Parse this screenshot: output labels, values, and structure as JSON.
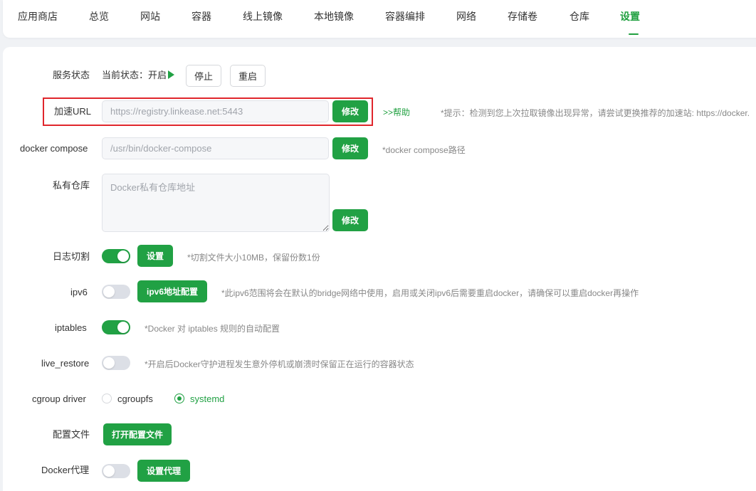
{
  "tabs": [
    {
      "label": "应用商店"
    },
    {
      "label": "总览"
    },
    {
      "label": "网站"
    },
    {
      "label": "容器"
    },
    {
      "label": "线上镜像"
    },
    {
      "label": "本地镜像"
    },
    {
      "label": "容器编排"
    },
    {
      "label": "网络"
    },
    {
      "label": "存储卷"
    },
    {
      "label": "仓库"
    },
    {
      "label": "设置",
      "active": true
    }
  ],
  "service": {
    "label": "服务状态",
    "status_text": "当前状态：开启",
    "stop_label": "停止",
    "restart_label": "重启"
  },
  "mirror": {
    "label": "加速URL",
    "placeholder": "https://registry.linkease.net:5443",
    "modify_label": "修改",
    "help_link": ">>帮助",
    "hint": "*提示：检测到您上次拉取镜像出现异常，请尝试更换推荐的加速站: https://docker."
  },
  "compose": {
    "label": "docker compose",
    "placeholder": "/usr/bin/docker-compose",
    "modify_label": "修改",
    "hint": "*docker compose路径"
  },
  "private_registry": {
    "label": "私有仓库",
    "placeholder": "Docker私有仓库地址",
    "modify_label": "修改"
  },
  "log_rotate": {
    "label": "日志切割",
    "enabled": true,
    "button_label": "设置",
    "hint": "*切割文件大小10MB，保留份数1份"
  },
  "ipv6": {
    "label": "ipv6",
    "enabled": false,
    "button_label": "ipv6地址配置",
    "hint": "*此ipv6范围将会在默认的bridge网络中使用，启用或关闭ipv6后需要重启docker，请确保可以重启docker再操作"
  },
  "iptables": {
    "label": "iptables",
    "enabled": true,
    "hint": "*Docker 对 iptables 规则的自动配置"
  },
  "live_restore": {
    "label": "live_restore",
    "enabled": false,
    "hint": "*开启后Docker守护进程发生意外停机或崩溃时保留正在运行的容器状态"
  },
  "cgroup": {
    "label": "cgroup driver",
    "options": [
      "cgroupfs",
      "systemd"
    ],
    "selected": "systemd"
  },
  "config_file": {
    "label": "配置文件",
    "button_label": "打开配置文件"
  },
  "proxy": {
    "label": "Docker代理",
    "enabled": false,
    "button_label": "设置代理"
  },
  "colors": {
    "accent": "#21a144",
    "highlight": "#e0262c"
  }
}
